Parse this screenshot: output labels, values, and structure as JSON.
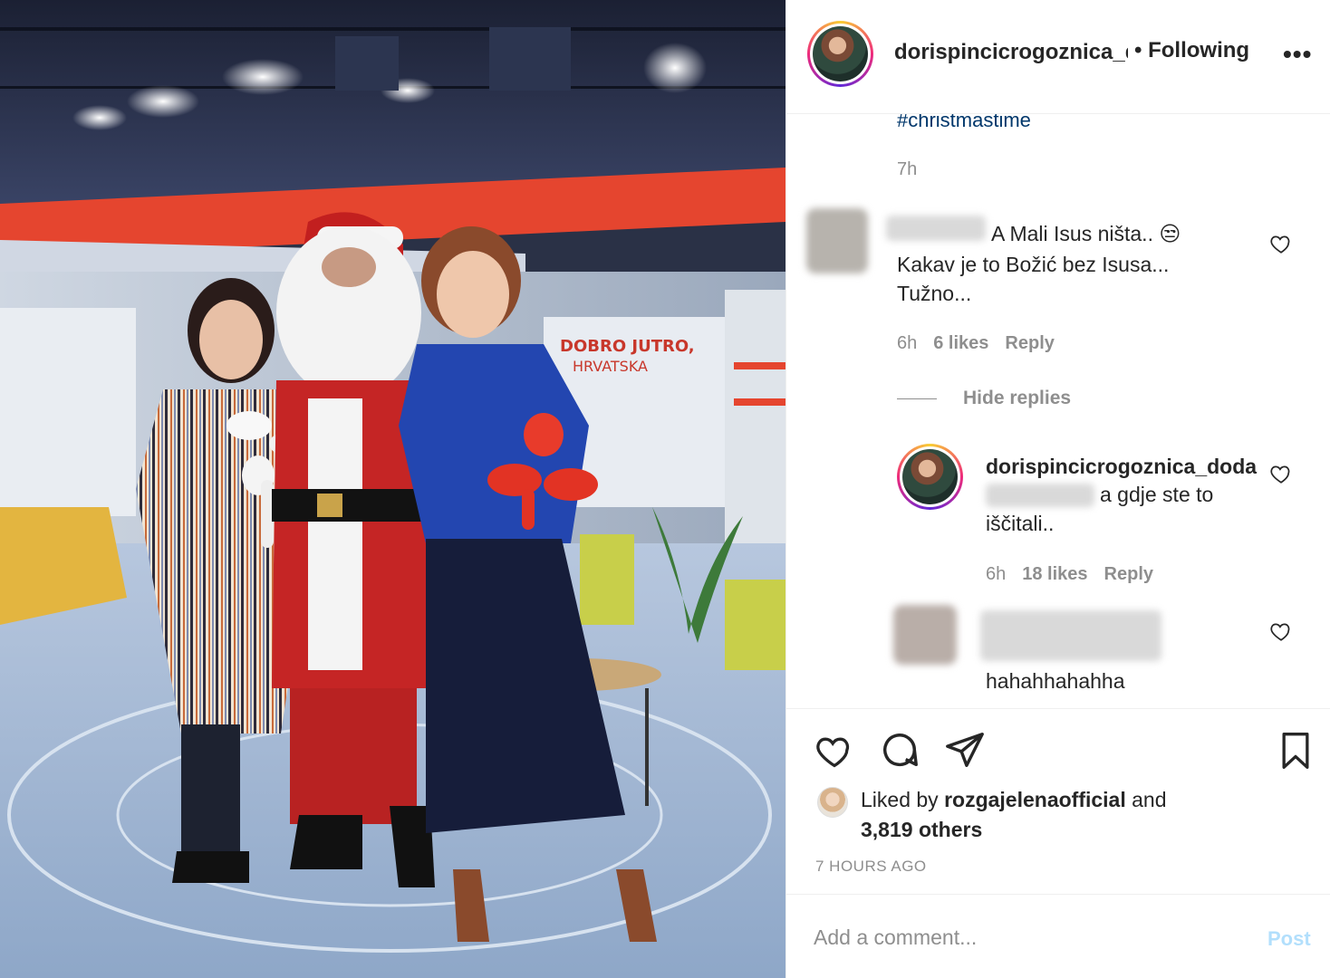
{
  "header": {
    "username": "dorispincicrogoznica_doda",
    "separator": "•",
    "follow_status": "Following",
    "more": "•••"
  },
  "caption": {
    "hashtag": "#christmastime",
    "time": "7h"
  },
  "comments": [
    {
      "text_line1": "A Mali Isus ništa.. 😒",
      "text_line2": "Kakav je to Božić bez Isusa...",
      "text_line3": "Tužno...",
      "time": "6h",
      "likes": "6 likes",
      "reply": "Reply"
    }
  ],
  "hide_replies": "Hide replies",
  "reply": {
    "username": "dorispincicrogoznica_doda",
    "text_line1": "a gdje ste to",
    "text_line2": "iščitali..",
    "time": "6h",
    "likes": "18 likes",
    "reply": "Reply"
  },
  "comment3": {
    "text": "hahahhahahha"
  },
  "likes": {
    "prefix": "Liked by",
    "user": "rozgajelenaofficial",
    "and": "and",
    "others": "3,819 others"
  },
  "timestamp": "7 HOURS AGO",
  "add_comment": {
    "placeholder": "Add a comment...",
    "post": "Post"
  },
  "icons": [
    "heart-icon",
    "comment-icon",
    "share-icon",
    "bookmark-icon",
    "more-icon"
  ],
  "colors": {
    "link": "#00376b",
    "muted": "#8e8e8e",
    "post_disabled": "#b2dffc",
    "studio_red": "#e5452f"
  }
}
